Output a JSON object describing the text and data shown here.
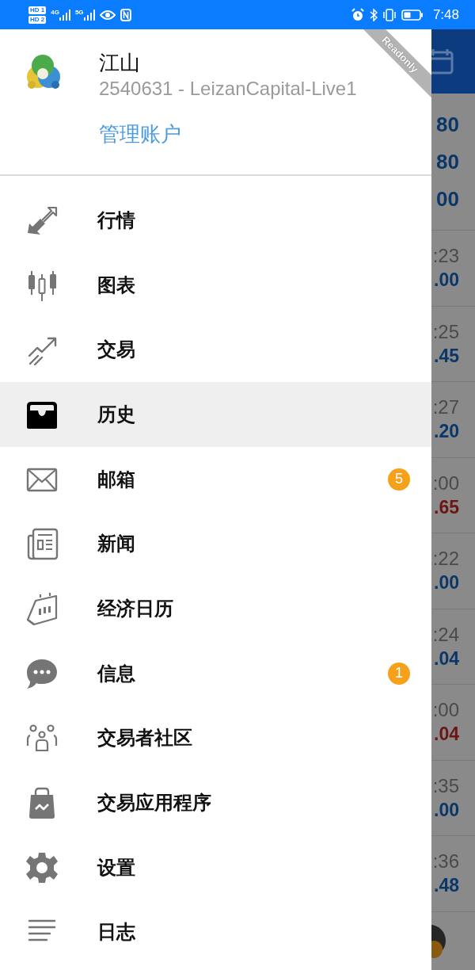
{
  "status_bar": {
    "sim_labels": [
      "HD 1",
      "HD 2"
    ],
    "networks": [
      "4G",
      "5G"
    ],
    "time": "7:48"
  },
  "account": {
    "name": "江山",
    "login": "2540631 - LeizanCapital-Live1",
    "manage_link": "管理账户",
    "ribbon": "Readonly"
  },
  "menu": [
    {
      "label": "行情",
      "selected": false
    },
    {
      "label": "图表",
      "selected": false
    },
    {
      "label": "交易",
      "selected": false
    },
    {
      "label": "历史",
      "selected": true
    },
    {
      "label": "邮箱",
      "selected": false,
      "badge": "5"
    },
    {
      "label": "新闻",
      "selected": false
    },
    {
      "label": "经济日历",
      "selected": false
    },
    {
      "label": "信息",
      "selected": false,
      "badge": "1"
    },
    {
      "label": "交易者社区",
      "selected": false
    },
    {
      "label": "交易应用程序",
      "selected": false
    },
    {
      "label": "设置",
      "selected": false
    },
    {
      "label": "日志",
      "selected": false
    }
  ],
  "background": {
    "summary_values": [
      "80",
      "80",
      "00"
    ],
    "rows": [
      {
        "time": ":23",
        "value": ".00",
        "color": "#0b3668"
      },
      {
        "time": ":25",
        "value": ".45",
        "color": "#0b3668"
      },
      {
        "time": ":27",
        "value": ".20",
        "color": "#0b3668"
      },
      {
        "time": ":00",
        "value": ".65",
        "color": "#6b1515"
      },
      {
        "time": ":22",
        "value": ".00",
        "color": "#0b3668"
      },
      {
        "time": ":24",
        "value": ".04",
        "color": "#0b3668"
      },
      {
        "time": ":00",
        "value": ".04",
        "color": "#6b1515"
      },
      {
        "time": ":35",
        "value": ".00",
        "color": "#0b3668"
      },
      {
        "time": ":36",
        "value": ".48",
        "color": "#0b3668"
      }
    ]
  }
}
